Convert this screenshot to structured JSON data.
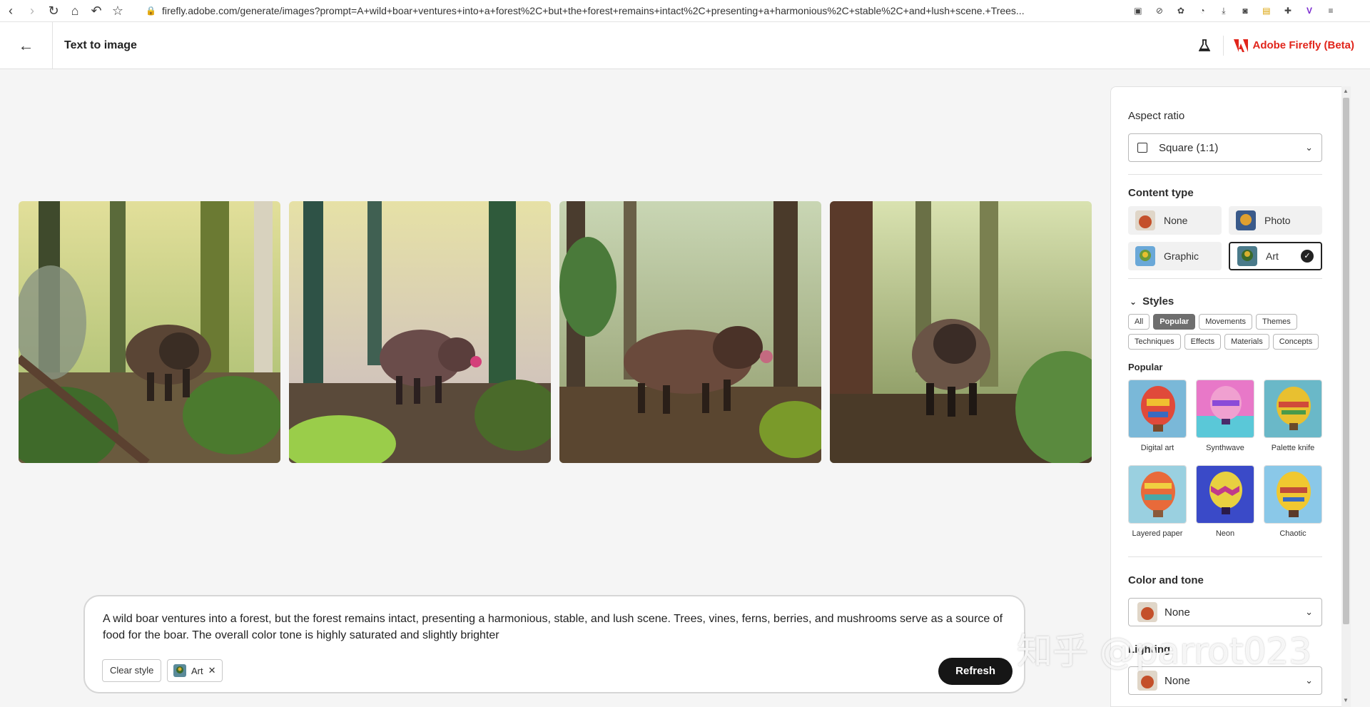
{
  "browser": {
    "url": "firefly.adobe.com/generate/images?prompt=A+wild+boar+ventures+into+a+forest%2C+but+the+forest+remains+intact%2C+presenting+a+harmonious%2C+stable%2C+and+lush+scene.+Trees...",
    "download_badge": "1"
  },
  "header": {
    "title": "Text to image",
    "brand": "Adobe Firefly (Beta)"
  },
  "prompt": {
    "text": "A wild boar ventures into a forest, but the forest remains intact, presenting a harmonious, stable, and lush scene. Trees, vines, ferns, berries, and mushrooms serve as a source of food for the boar. The overall color tone is highly saturated and slightly brighter",
    "clear_style_label": "Clear style",
    "active_style": "Art",
    "refresh_label": "Refresh"
  },
  "panel": {
    "aspect_ratio": {
      "title": "Aspect ratio",
      "value": "Square (1:1)"
    },
    "content_type": {
      "title": "Content type",
      "options": [
        {
          "label": "None",
          "selected": false
        },
        {
          "label": "Photo",
          "selected": false
        },
        {
          "label": "Graphic",
          "selected": false
        },
        {
          "label": "Art",
          "selected": true
        }
      ]
    },
    "styles": {
      "title": "Styles",
      "tabs_row1": [
        "All",
        "Popular",
        "Movements",
        "Themes"
      ],
      "tabs_row2": [
        "Techniques",
        "Effects",
        "Materials",
        "Concepts"
      ],
      "active_tab": "Popular",
      "section_label": "Popular",
      "items": [
        "Digital art",
        "Synthwave",
        "Palette knife",
        "Layered paper",
        "Neon",
        "Chaotic"
      ]
    },
    "color_tone": {
      "title": "Color and tone",
      "value": "None"
    },
    "lighting": {
      "title": "Lighting",
      "value": "None"
    }
  },
  "watermark": "知乎 @parrot023"
}
